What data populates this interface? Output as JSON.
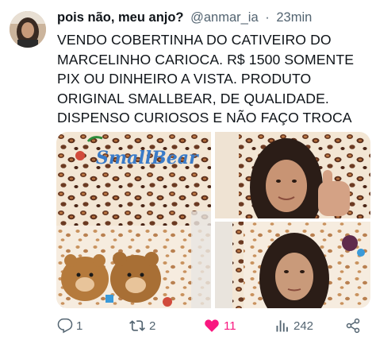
{
  "author": {
    "display_name": "pois não, meu anjo?",
    "handle": "@anmar_ia",
    "separator": "·",
    "time": "23min"
  },
  "tweet_lines": [
    "VENDO COBERTINHA DO CATIVEIRO DO",
    "MARCELINHO CARIOCA. R$ 1500 SOMENTE",
    "PIX OU DINHEIRO A VISTA. PRODUTO",
    "ORIGINAL SMALLBEAR, DE QUALIDADE.",
    "DISPENSO CURIOSOS E NÃO FAÇO TROCA"
  ],
  "media": {
    "blanket_brand_text": "SmallBear"
  },
  "actions": {
    "reply_count": "1",
    "retweet_count": "2",
    "like_count": "11",
    "views_count": "242"
  },
  "colors": {
    "like_active": "#f91880",
    "secondary_text": "#536471"
  },
  "icons": [
    "reply-icon",
    "retweet-icon",
    "like-icon",
    "views-icon",
    "share-icon"
  ]
}
